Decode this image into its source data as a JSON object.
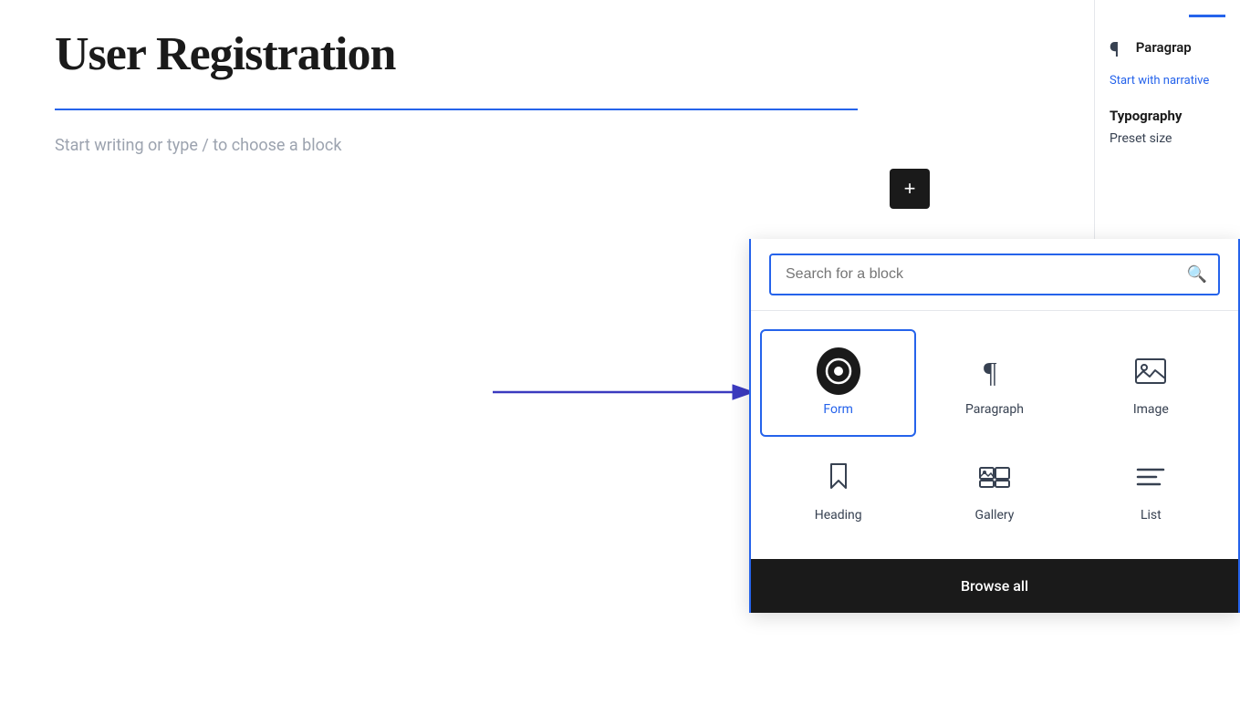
{
  "page": {
    "title": "User Registration",
    "placeholder": "Start writing or type / to choose a block"
  },
  "add_button": {
    "label": "+"
  },
  "block_picker": {
    "search_placeholder": "Search for a block",
    "blocks": [
      {
        "id": "form",
        "label": "Form",
        "selected": true
      },
      {
        "id": "paragraph",
        "label": "Paragraph",
        "selected": false
      },
      {
        "id": "image",
        "label": "Image",
        "selected": false
      },
      {
        "id": "heading",
        "label": "Heading",
        "selected": false
      },
      {
        "id": "gallery",
        "label": "Gallery",
        "selected": false
      },
      {
        "id": "list",
        "label": "List",
        "selected": false
      }
    ],
    "browse_all_label": "Browse all"
  },
  "sidebar": {
    "paragraph_label": "Paragrap",
    "paragraph_desc": "Start with narrative",
    "typography_label": "Typography",
    "preset_size_label": "Preset size"
  }
}
